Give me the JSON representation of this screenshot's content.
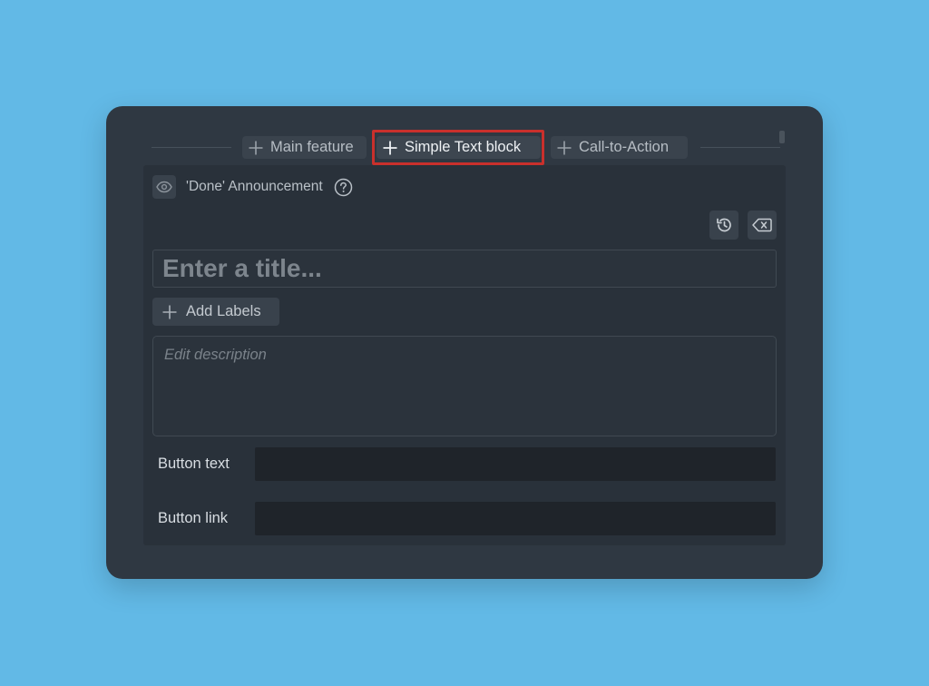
{
  "tabs": [
    {
      "label": "Main feature"
    },
    {
      "label": "Simple Text block",
      "highlighted": true
    },
    {
      "label": "Call-to-Action"
    }
  ],
  "block": {
    "announcement_title": "'Done' Announcement",
    "title_placeholder": "Enter a title...",
    "add_labels_label": "Add Labels",
    "description_placeholder": "Edit description",
    "button_text_label": "Button text",
    "button_text_value": "",
    "button_link_label": "Button link",
    "button_link_value": ""
  },
  "icons": {
    "visibility": "eye-icon",
    "help": "help-circle-icon",
    "history": "history-icon",
    "clear": "backspace-icon",
    "add": "plus-icon"
  },
  "colors": {
    "background": "#62b9e6",
    "panel": "#2f3842",
    "highlight": "#c9302c"
  }
}
